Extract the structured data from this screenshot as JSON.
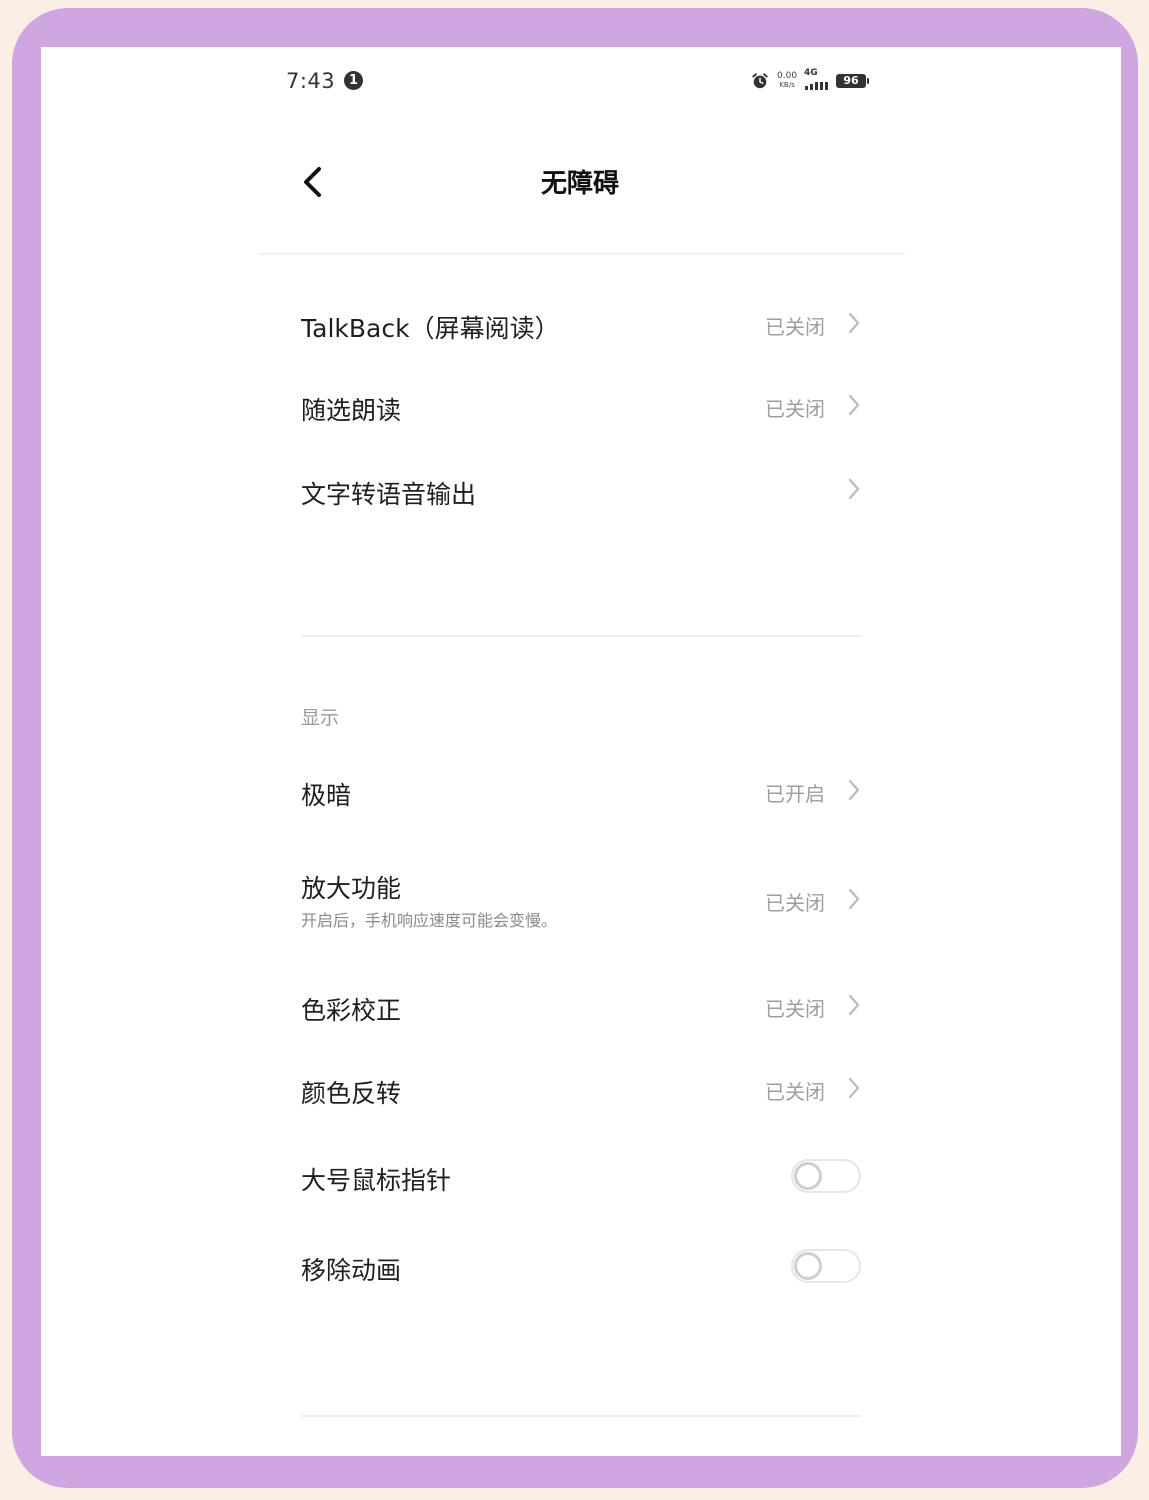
{
  "status_bar": {
    "time": "7:43",
    "notification_count": "1",
    "net_speed_value": "0.00",
    "net_speed_unit": "KB/s",
    "network_type": "4G",
    "battery": "96"
  },
  "header": {
    "title": "无障碍"
  },
  "items": {
    "talkback": {
      "label": "TalkBack（屏幕阅读）",
      "value": "已关闭"
    },
    "select_to_speak": {
      "label": "随选朗读",
      "value": "已关闭"
    },
    "tts_output": {
      "label": "文字转语音输出"
    },
    "display_section_title": "显示",
    "extra_dim": {
      "label": "极暗",
      "value": "已开启"
    },
    "magnification": {
      "label": "放大功能",
      "subtitle": "开启后，手机响应速度可能会变慢。",
      "value": "已关闭"
    },
    "color_correction": {
      "label": "色彩校正",
      "value": "已关闭"
    },
    "color_inversion": {
      "label": "颜色反转",
      "value": "已关闭"
    },
    "large_pointer": {
      "label": "大号鼠标指针",
      "enabled": false
    },
    "remove_animations": {
      "label": "移除动画",
      "enabled": false
    }
  }
}
